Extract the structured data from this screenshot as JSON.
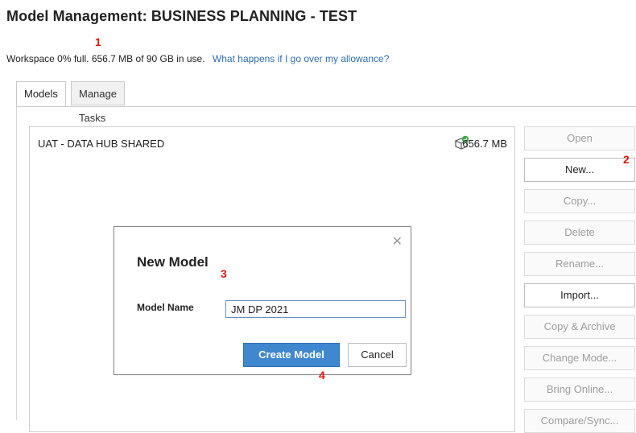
{
  "page_title": "Model Management: BUSINESS PLANNING - TEST",
  "workspace": {
    "usage_text": "Workspace 0% full.  656.7 MB of 90 GB in use.",
    "help_link": "What happens if I go over my allowance?"
  },
  "tabs": [
    {
      "label": "Models",
      "active": true
    },
    {
      "label": "Manage Tasks",
      "active": false
    }
  ],
  "models": [
    {
      "name": "UAT - DATA HUB SHARED",
      "size": "656.7 MB",
      "icon": "model-online-icon"
    }
  ],
  "actions": [
    {
      "label": "Open",
      "enabled": false
    },
    {
      "label": "New...",
      "enabled": true
    },
    {
      "label": "Copy...",
      "enabled": false
    },
    {
      "label": "Delete",
      "enabled": false
    },
    {
      "label": "Rename...",
      "enabled": false
    },
    {
      "label": "Import...",
      "enabled": true
    },
    {
      "label": "Copy & Archive",
      "enabled": false
    },
    {
      "label": "Change Mode...",
      "enabled": false
    },
    {
      "label": "Bring Online...",
      "enabled": false
    },
    {
      "label": "Compare/Sync...",
      "enabled": false
    }
  ],
  "dialog": {
    "title": "New Model",
    "close_icon": "close-icon",
    "field_label": "Model Name",
    "field_value": "JM DP 2021",
    "create_label": "Create Model",
    "cancel_label": "Cancel"
  },
  "annotations": [
    "1",
    "2",
    "3",
    "4"
  ],
  "colors": {
    "link": "#2f6fb0",
    "primary": "#3f87cf",
    "annotation": "#e3140e"
  }
}
